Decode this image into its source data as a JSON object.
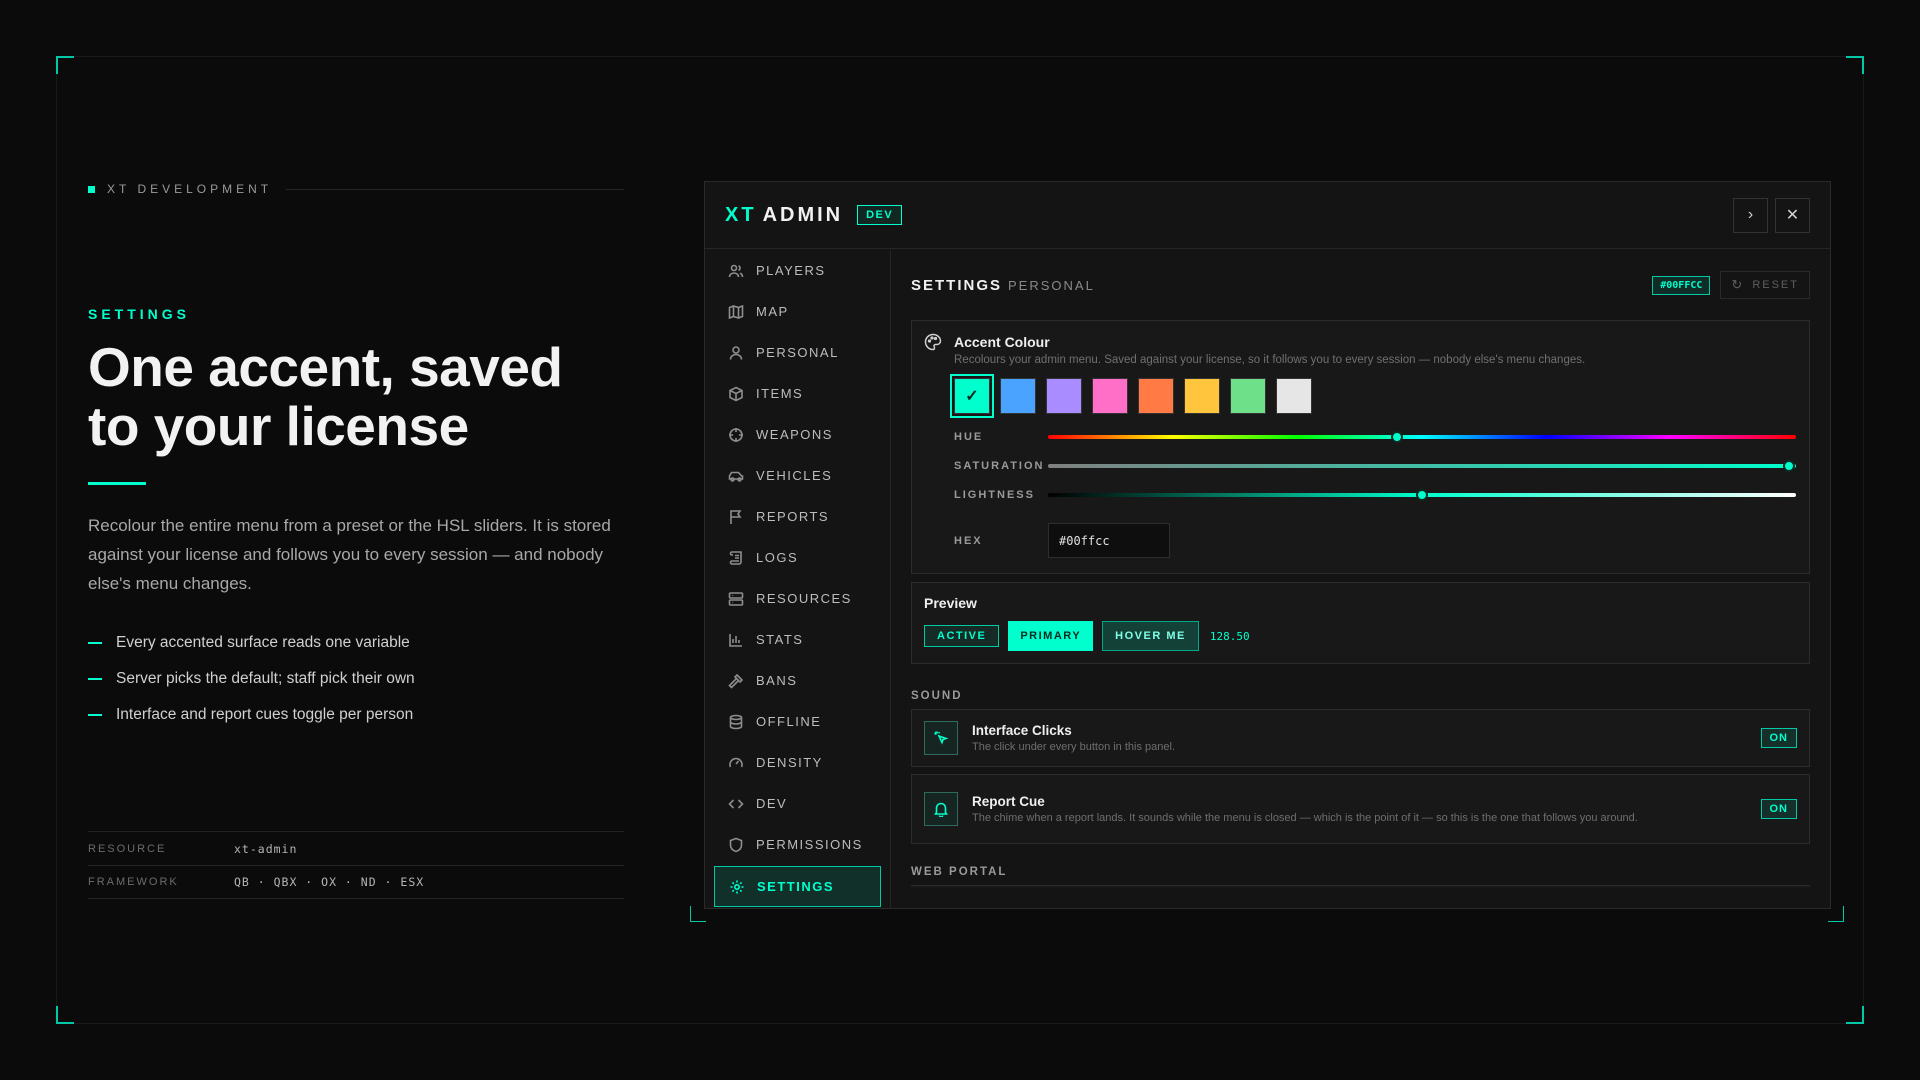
{
  "hero": {
    "brand": "XT DEVELOPMENT",
    "eyebrow": "SETTINGS",
    "title_line1": "One accent, saved",
    "title_line2": "to your license",
    "description": "Recolour the entire menu from a preset or the HSL sliders. It is stored against your license and follows you to every session — and nobody else's menu changes.",
    "bullets": [
      "Every accented surface reads one variable",
      "Server picks the default; staff pick their own",
      "Interface and report cues toggle per person"
    ],
    "meta": [
      {
        "key": "RESOURCE",
        "value": "xt-admin"
      },
      {
        "key": "FRAMEWORK",
        "value": "QB · QBX · OX · ND · ESX"
      }
    ]
  },
  "panel": {
    "logo_prefix": "XT",
    "logo_name": "ADMIN",
    "badge": "DEV",
    "nav": [
      {
        "label": "PLAYERS",
        "icon": "users-icon"
      },
      {
        "label": "MAP",
        "icon": "map-icon"
      },
      {
        "label": "PERSONAL",
        "icon": "user-icon"
      },
      {
        "label": "ITEMS",
        "icon": "box-icon"
      },
      {
        "label": "WEAPONS",
        "icon": "crosshair-icon"
      },
      {
        "label": "VEHICLES",
        "icon": "car-icon"
      },
      {
        "label": "REPORTS",
        "icon": "flag-icon"
      },
      {
        "label": "LOGS",
        "icon": "scroll-icon"
      },
      {
        "label": "RESOURCES",
        "icon": "server-icon"
      },
      {
        "label": "STATS",
        "icon": "bar-chart-icon"
      },
      {
        "label": "BANS",
        "icon": "gavel-icon"
      },
      {
        "label": "OFFLINE",
        "icon": "database-icon"
      },
      {
        "label": "DENSITY",
        "icon": "gauge-icon"
      },
      {
        "label": "DEV",
        "icon": "code-icon"
      },
      {
        "label": "PERMISSIONS",
        "icon": "shield-icon"
      },
      {
        "label": "SETTINGS",
        "icon": "gear-icon",
        "active": true
      }
    ],
    "settings": {
      "title": "SETTINGS",
      "subtitle": "PERSONAL",
      "hex_chip": "#00FFCC",
      "reset_label": "RESET",
      "accent": {
        "title": "Accent Colour",
        "description": "Recolours your admin menu. Saved against your license, so it follows you to every session — nobody else's menu changes.",
        "swatches": [
          "#00ffcc",
          "#4aa3ff",
          "#a98cff",
          "#ff6fc7",
          "#ff7a45",
          "#ffc53d",
          "#6fe08a",
          "#e6e6e6"
        ],
        "selected_index": 0,
        "hue_label": "HUE",
        "saturation_label": "SATURATION",
        "lightness_label": "LIGHTNESS",
        "hue_level": 0.466,
        "saturation_level": 0.99,
        "lightness_level": 0.5,
        "hex_label": "HEX",
        "hex_value": "#00ffcc"
      },
      "preview": {
        "title": "Preview",
        "active": "ACTIVE",
        "primary": "PRIMARY",
        "hover": "HOVER ME",
        "number": "128.50"
      },
      "sound_label": "SOUND",
      "sounds": [
        {
          "title": "Interface Clicks",
          "description": "The click under every button in this panel.",
          "state": "ON"
        },
        {
          "title": "Report Cue",
          "description": "The chime when a report lands. It sounds while the menu is closed — which is the point of it — so this is the one that follows you around.",
          "state": "ON"
        }
      ],
      "web_portal_label": "WEB PORTAL"
    }
  },
  "colors": {
    "accent": "#00ffcc",
    "background": "#0b0b0b",
    "panel": "#141414"
  }
}
